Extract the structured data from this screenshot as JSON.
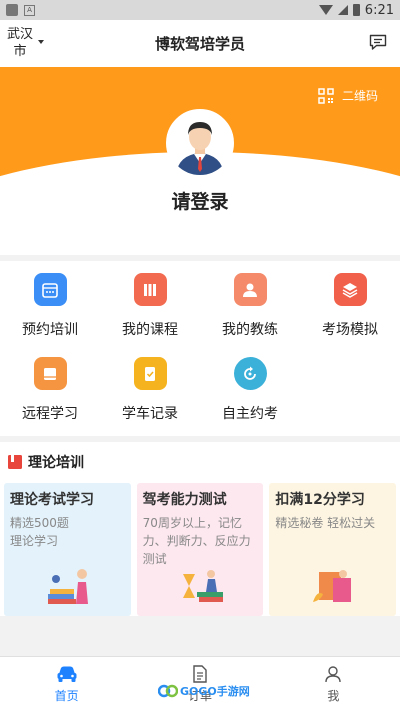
{
  "status_bar": {
    "time": "6:21"
  },
  "navbar": {
    "city": "武汉市",
    "title": "博软驾培学员"
  },
  "hero": {
    "qr_label": "二维码",
    "login_label": "请登录"
  },
  "menu": {
    "items": [
      {
        "label": "预约培训",
        "icon": "calendar-icon",
        "color": "#3a8ef6"
      },
      {
        "label": "我的课程",
        "icon": "books-icon",
        "color": "#f26a4f"
      },
      {
        "label": "我的教练",
        "icon": "person-icon",
        "color": "#f48a6a"
      },
      {
        "label": "考场模拟",
        "icon": "layers-icon",
        "color": "#f0604a"
      },
      {
        "label": "远程学习",
        "icon": "book-icon",
        "color": "#f59542"
      },
      {
        "label": "学车记录",
        "icon": "record-icon",
        "color": "#f5b320"
      },
      {
        "label": "自主约考",
        "icon": "refresh-icon",
        "color": "#3bb0d8"
      }
    ]
  },
  "theory": {
    "title": "理论培训",
    "cards": [
      {
        "title": "理论考试学习",
        "desc": "精选500题\n理论学习",
        "bg": "#e3f2fb"
      },
      {
        "title": "驾考能力测试",
        "desc": "70周岁以上，记忆力、判断力、反应力测试",
        "bg": "#fde8f0"
      },
      {
        "title": "扣满12分学习",
        "desc": "精选秘卷 轻松过关",
        "bg": "#fdf5e2"
      }
    ]
  },
  "tabbar": {
    "tabs": [
      {
        "label": "首页",
        "icon": "car-icon",
        "active": true
      },
      {
        "label": "订单",
        "icon": "document-icon",
        "active": false
      },
      {
        "label": "我",
        "icon": "user-icon",
        "active": false
      }
    ]
  },
  "watermark": {
    "text": "GOGO手游网"
  },
  "colors": {
    "accent": "#ff9a1a",
    "tab_active": "#1e82ff"
  }
}
